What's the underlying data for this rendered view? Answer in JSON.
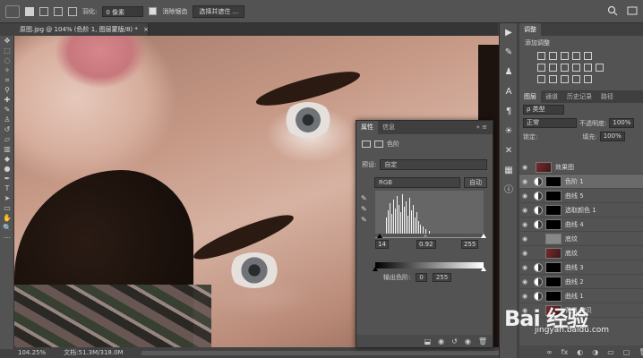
{
  "options_bar": {
    "feather_label": "羽化:",
    "feather_value": "0 像素",
    "antialias_label": "消除锯齿",
    "select_mask_button": "选择并遮住 ..."
  },
  "document": {
    "tab_title": "原图.jpg @ 104% (色阶 1, 图层蒙版/8) *",
    "close": "×"
  },
  "status_bar": {
    "zoom": "104.25%",
    "doc_info": "文档:51.3M/318.0M"
  },
  "properties_panel": {
    "tabs": [
      "属性",
      "信息"
    ],
    "active_tab": "属性",
    "adjustment_name": "色阶",
    "preset_label": "预设:",
    "preset_value": "自定",
    "channel_value": "RGB",
    "auto_button": "自动",
    "input_black": "14",
    "input_gamma": "0.92",
    "input_white": "255",
    "output_label": "输出色阶:",
    "output_black": "0",
    "output_white": "255"
  },
  "adjustments_panel": {
    "tab_label": "调整",
    "add_adjustment_label": "添加调整"
  },
  "layers_panel": {
    "tabs": [
      "图层",
      "通道",
      "历史记录",
      "路径"
    ],
    "active_tab": "图层",
    "filter_kind": "ρ 类型",
    "blend_mode": "正常",
    "opacity_label": "不透明度:",
    "opacity_value": "100%",
    "lock_label": "锁定:",
    "fill_label": "填充:",
    "fill_value": "100%",
    "group_name": "效果图",
    "layers": [
      {
        "name": "色阶 1",
        "thumb": "black",
        "type": "adjustment",
        "selected": true
      },
      {
        "name": "曲线 5",
        "thumb": "black",
        "type": "adjustment",
        "selected": false
      },
      {
        "name": "选取颜色 1",
        "thumb": "black",
        "type": "adjustment",
        "selected": false
      },
      {
        "name": "曲线 4",
        "thumb": "black",
        "type": "adjustment",
        "selected": false
      },
      {
        "name": "底纹",
        "thumb": "gray",
        "type": "pixel",
        "selected": false
      },
      {
        "name": "底纹",
        "thumb": "photo",
        "type": "pixel",
        "selected": false
      },
      {
        "name": "曲线 3",
        "thumb": "black",
        "type": "adjustment",
        "selected": false
      },
      {
        "name": "曲线 2",
        "thumb": "black",
        "type": "adjustment",
        "selected": false
      },
      {
        "name": "曲线 1",
        "thumb": "black",
        "type": "adjustment",
        "selected": false
      },
      {
        "name": "背景 拷贝",
        "thumb": "photo",
        "type": "pixel",
        "selected": false
      }
    ]
  },
  "watermark": {
    "brand": "Bai 经验",
    "url": "jingyan.baidu.com"
  }
}
